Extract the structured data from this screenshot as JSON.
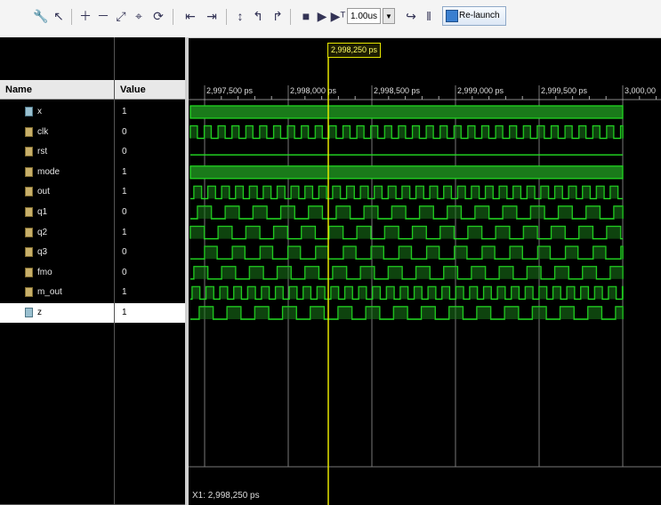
{
  "toolbar": {
    "zoom_value": "1.00us",
    "relaunch_label": "Re-launch"
  },
  "columns": {
    "name": "Name",
    "value": "Value"
  },
  "signals": [
    {
      "name": "x",
      "value": "1"
    },
    {
      "name": "clk",
      "value": "0"
    },
    {
      "name": "rst",
      "value": "0"
    },
    {
      "name": "mode",
      "value": "1"
    },
    {
      "name": "out",
      "value": "1"
    },
    {
      "name": "q1",
      "value": "0"
    },
    {
      "name": "q2",
      "value": "1"
    },
    {
      "name": "q3",
      "value": "0"
    },
    {
      "name": "fmo",
      "value": "0"
    },
    {
      "name": "m_out",
      "value": "1"
    },
    {
      "name": "z",
      "value": "1"
    }
  ],
  "timeline": {
    "ticks": [
      "2,997,500 ps",
      "2,998,000 ps",
      "2,998,500 ps",
      "2,999,000 ps",
      "2,999,500 ps",
      "3,000,00"
    ],
    "cursor_label": "2,998,250 ps",
    "cursor_readout": "X1: 2,998,250 ps"
  },
  "colors": {
    "wave": "#22e022",
    "wave_fill": "#1a7a1a",
    "cursor": "#e6e600",
    "grid": "#c8c8c8"
  }
}
